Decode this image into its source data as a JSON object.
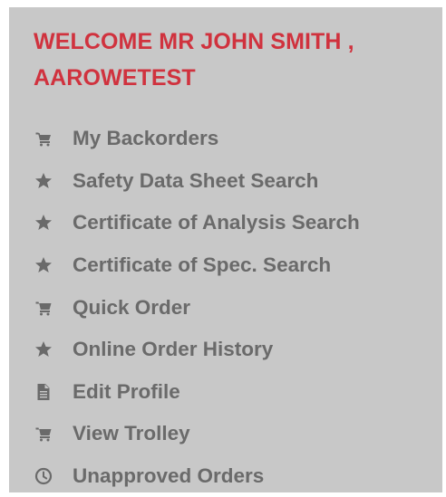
{
  "welcome": {
    "line1": "WELCOME MR JOHN SMITH ,",
    "line2": "AAROWETEST"
  },
  "colors": {
    "panel_bg": "#c8c8c8",
    "welcome_text": "#d0323e",
    "menu_text": "#6a6a6a"
  },
  "menu": {
    "items": [
      {
        "label": "My Backorders",
        "icon": "cart-icon"
      },
      {
        "label": "Safety Data Sheet Search",
        "icon": "star-icon"
      },
      {
        "label": "Certificate of Analysis Search",
        "icon": "star-icon"
      },
      {
        "label": "Certificate of Spec. Search",
        "icon": "star-icon"
      },
      {
        "label": "Quick Order",
        "icon": "cart-icon"
      },
      {
        "label": "Online Order History",
        "icon": "star-icon"
      },
      {
        "label": "Edit Profile",
        "icon": "document-icon"
      },
      {
        "label": "View Trolley",
        "icon": "cart-icon"
      },
      {
        "label": "Unapproved Orders",
        "icon": "clock-icon"
      }
    ]
  }
}
